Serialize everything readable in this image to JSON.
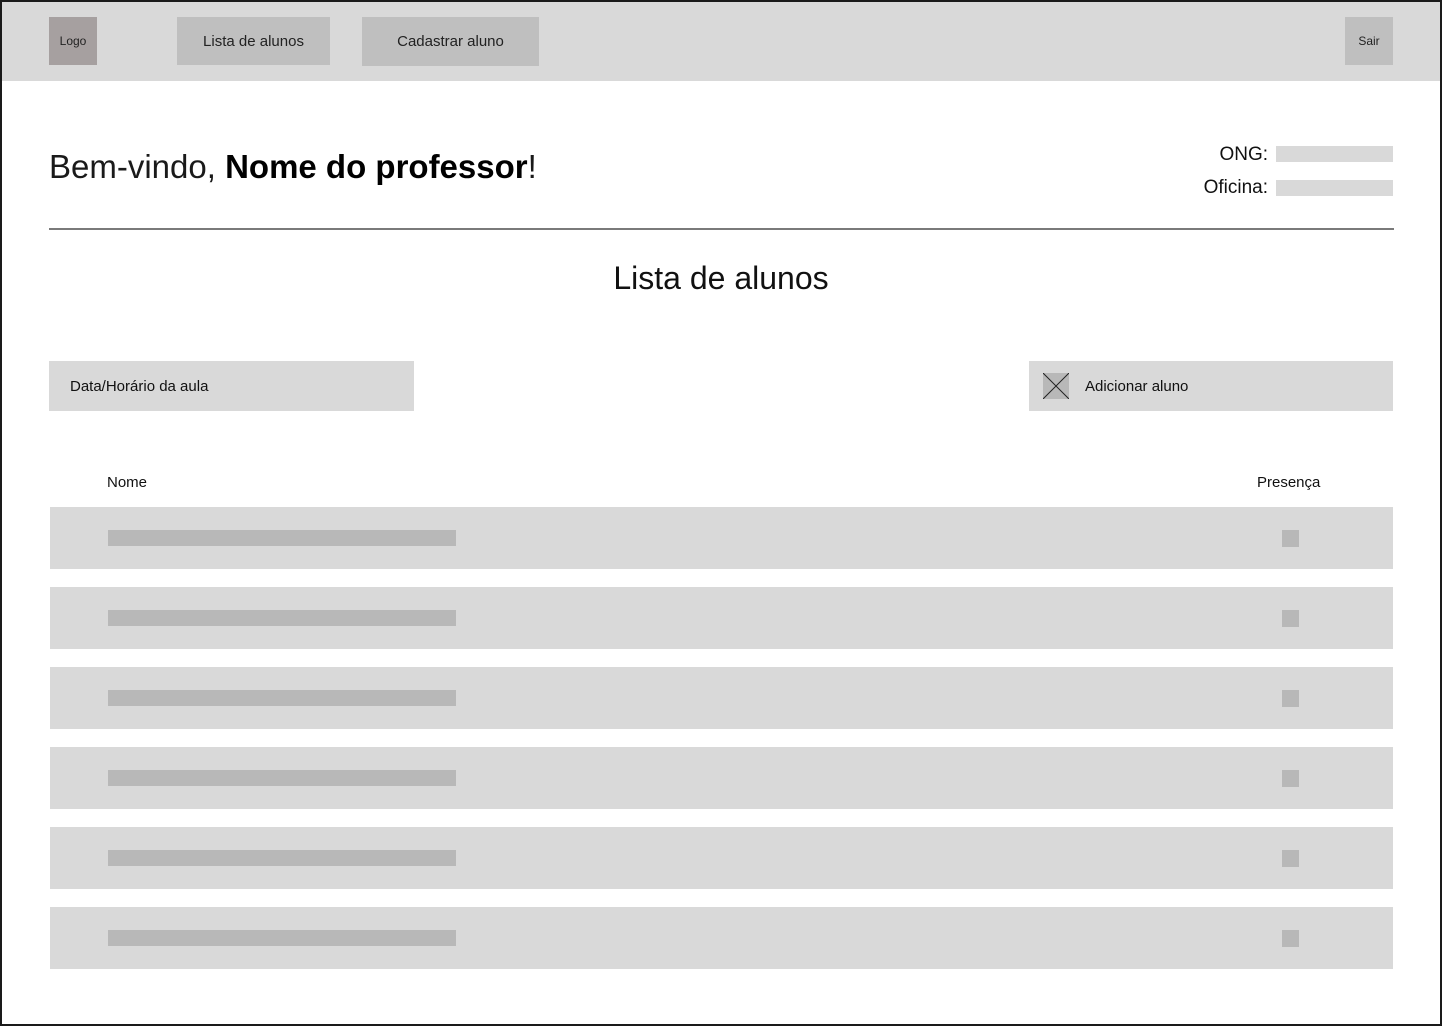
{
  "header": {
    "logo_label": "Logo",
    "nav": [
      {
        "label": "Lista de alunos"
      },
      {
        "label": "Cadastrar aluno"
      }
    ],
    "logout_label": "Sair"
  },
  "welcome": {
    "prefix": "Bem-vindo, ",
    "name": "Nome do professor",
    "suffix": "!"
  },
  "info": {
    "ong_label": "ONG:",
    "oficina_label": "Oficina:"
  },
  "page_title": "Lista de alunos",
  "controls": {
    "date_field_label": "Data/Horário da aula",
    "add_button_label": "Adicionar aluno",
    "add_button_icon": "image-placeholder-icon"
  },
  "table": {
    "columns": [
      "Nome",
      "Presença"
    ],
    "row_count": 6
  },
  "colors": {
    "bar": "#d9d9d9",
    "placeholder": "#b8b8b8",
    "button": "#bfbfbf",
    "logo": "#a6a0a0"
  }
}
